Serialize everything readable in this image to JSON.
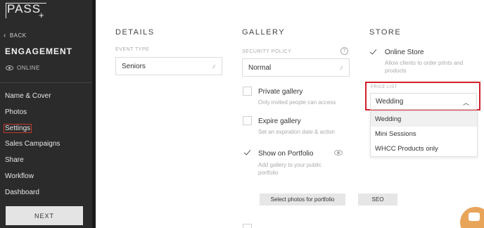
{
  "app": {
    "logo": "PASS"
  },
  "sidebar": {
    "back_label": "BACK",
    "title": "ENGAGEMENT",
    "status": "ONLINE",
    "items": [
      {
        "label": "Name & Cover"
      },
      {
        "label": "Photos"
      },
      {
        "label": "Settings"
      },
      {
        "label": "Sales Campaigns"
      },
      {
        "label": "Share"
      },
      {
        "label": "Workflow"
      },
      {
        "label": "Dashboard"
      }
    ],
    "next_label": "NEXT"
  },
  "details": {
    "title": "DETAILS",
    "event_type_label": "EVENT TYPE",
    "event_type_value": "Seniors"
  },
  "gallery": {
    "title": "GALLERY",
    "security_label": "SECURITY POLICY",
    "security_value": "Normal",
    "private_label": "Private gallery",
    "private_desc": "Only invited people can access",
    "expire_label": "Expire gallery",
    "expire_desc": "Set an expiration date & action",
    "portfolio_label": "Show on Portfolio",
    "portfolio_desc": "Add gallery to your public portfolio",
    "select_photos_label": "Select photos for portfolio",
    "seo_label": "SEO"
  },
  "store": {
    "title": "STORE",
    "online_store_label": "Online Store",
    "online_store_desc": "Allow clients to order prints and products",
    "price_list_label": "PRICE LIST",
    "price_list_value": "Wedding",
    "options": [
      {
        "label": "Wedding"
      },
      {
        "label": "Mini Sessions"
      },
      {
        "label": "WHCC Products only"
      }
    ]
  },
  "colors": {
    "sidebar_bg": "#2b2b2b",
    "highlight": "#d0202e",
    "chat": "#e8a55a"
  }
}
